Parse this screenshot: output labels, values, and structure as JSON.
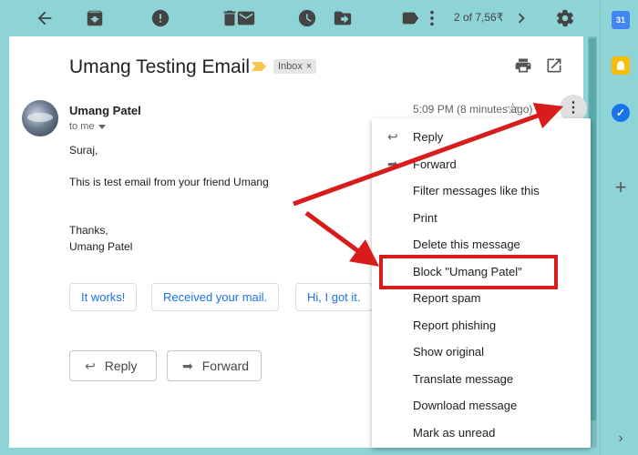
{
  "toolbar": {
    "count": "2 of 7,56₹",
    "icons": [
      "back-arrow-icon",
      "archive-icon",
      "report-spam-icon",
      "delete-icon",
      "mark-unread-icon",
      "snooze-icon",
      "move-to-icon",
      "labels-icon",
      "more-icon",
      "newer-icon",
      "settings-gear-icon"
    ]
  },
  "side_panel": {
    "calendar_label": "31",
    "tasks_label": "✓",
    "add_label": "+",
    "expand_label": "›"
  },
  "email": {
    "subject": "Umang Testing Email",
    "label": "Inbox",
    "label_close": "×",
    "sender": "Umang Patel",
    "to": "to me",
    "timestamp": "5:09 PM (8 minutes ago)",
    "greeting": "Suraj,",
    "body": "This is test email from your friend Umang",
    "signoff": "Thanks,",
    "signature": "Umang Patel"
  },
  "smart_replies": [
    "It works!",
    "Received your mail.",
    "Hi, I got it."
  ],
  "actions": {
    "reply": "Reply",
    "forward": "Forward"
  },
  "menu": {
    "items": [
      "Reply",
      "Forward",
      "Filter messages like this",
      "Print",
      "Delete this message",
      "Block \"Umang Patel\"",
      "Report spam",
      "Report phishing",
      "Show original",
      "Translate message",
      "Download message",
      "Mark as unread"
    ],
    "highlighted": "Block \"Umang Patel\""
  },
  "colors": {
    "background": "#8ed3d6",
    "accent": "#1a73e8",
    "annotation": "#d81b1b"
  }
}
